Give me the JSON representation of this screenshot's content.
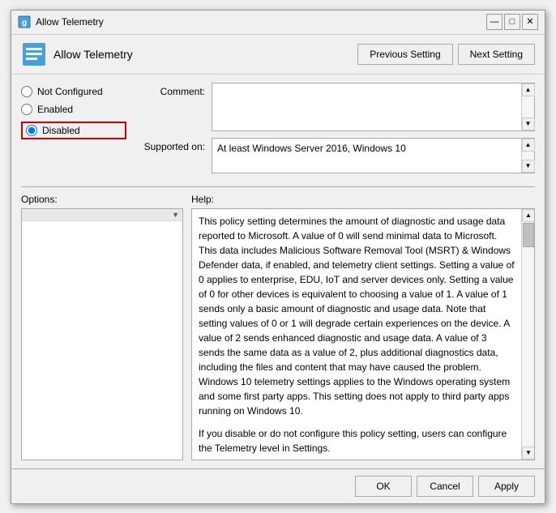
{
  "titleBar": {
    "title": "Allow Telemetry",
    "minimize": "—",
    "maximize": "□",
    "close": "✕"
  },
  "header": {
    "title": "Allow Telemetry",
    "prevButton": "Previous Setting",
    "nextButton": "Next Setting"
  },
  "radioOptions": {
    "notConfigured": "Not Configured",
    "enabled": "Enabled",
    "disabled": "Disabled"
  },
  "selectedOption": "disabled",
  "comment": {
    "label": "Comment:",
    "value": ""
  },
  "supportedOn": {
    "label": "Supported on:",
    "value": "At least Windows Server 2016, Windows 10"
  },
  "options": {
    "title": "Options:",
    "dropdownValue": ""
  },
  "help": {
    "title": "Help:",
    "text": "This policy setting determines the amount of diagnostic and usage data reported to Microsoft. A value of 0 will send minimal data to Microsoft. This data includes Malicious Software Removal Tool (MSRT) & Windows Defender data, if enabled, and telemetry client settings. Setting a value of 0 applies to enterprise, EDU, IoT and server devices only. Setting a value of 0 for other devices is equivalent to choosing a value of 1. A value of 1 sends only a basic amount of diagnostic and usage data. Note that setting values of 0 or 1 will degrade certain experiences on the device. A value of 2 sends enhanced diagnostic and usage data. A value of 3 sends the same data as a value of 2, plus additional diagnostics data, including the files and content that may have caused the problem. Windows 10 telemetry settings applies to the Windows operating system and some first party apps. This setting does not apply to third party apps running on Windows 10.",
    "text2": "If you disable or do not configure this policy setting, users can configure the Telemetry level in Settings."
  },
  "footer": {
    "ok": "OK",
    "cancel": "Cancel",
    "apply": "Apply"
  }
}
